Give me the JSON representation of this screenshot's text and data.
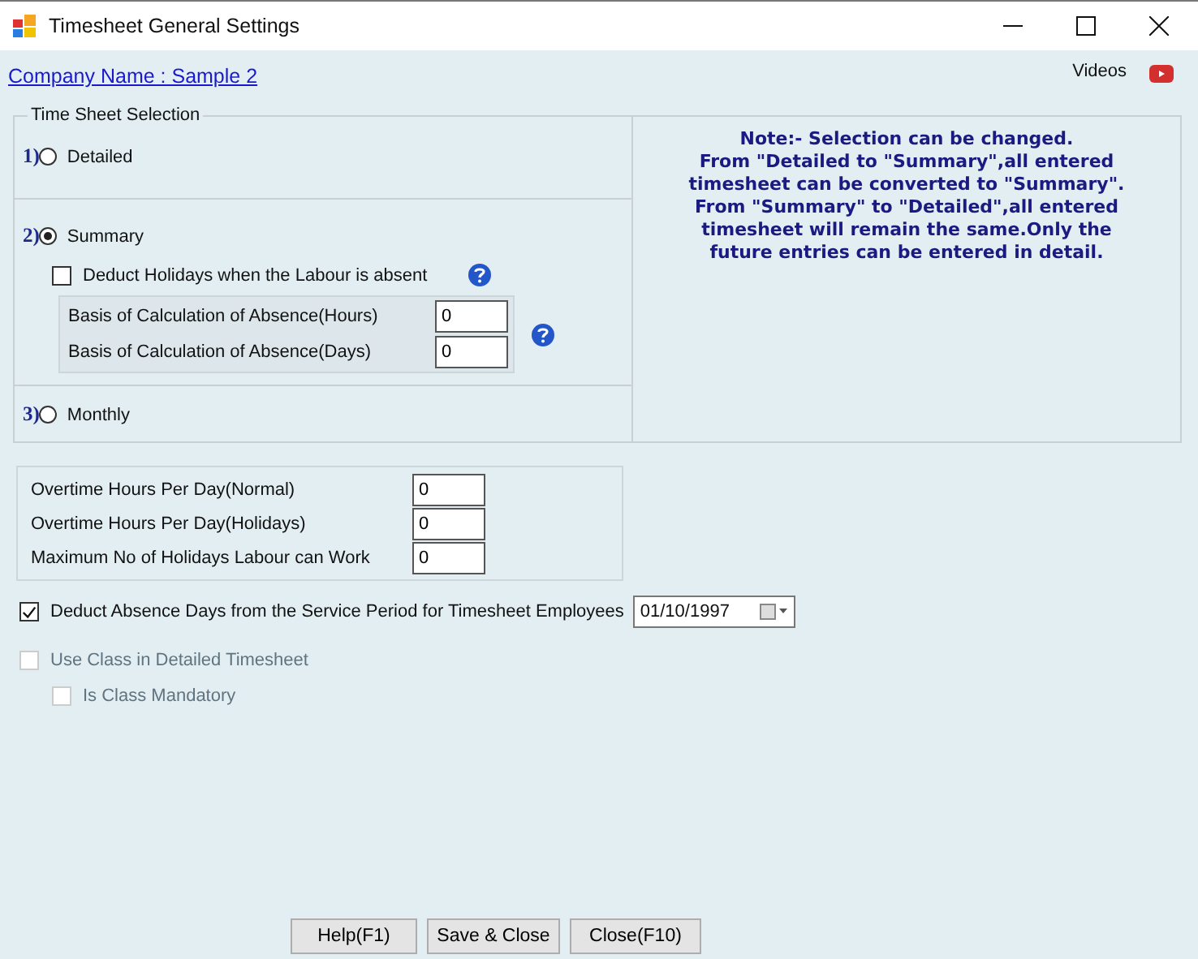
{
  "window": {
    "title": "Timesheet General Settings"
  },
  "company_link": "Company Name : Sample 2",
  "videos_label": "Videos",
  "selection": {
    "title": "Time Sheet Selection",
    "options": [
      {
        "number": "1)",
        "label": "Detailed",
        "selected": false,
        "kind": "plain"
      },
      {
        "number": "2)",
        "label": "Summary",
        "selected": true,
        "kind": "summary",
        "deduct_holidays": {
          "label": "Deduct Holidays when the Labour is absent",
          "checked": false
        },
        "fields": [
          {
            "label": "Basis of Calculation of Absence(Hours)",
            "value": "0"
          },
          {
            "label": "Basis of Calculation of Absence(Days)",
            "value": "0"
          }
        ]
      },
      {
        "number": "3)",
        "label": "Monthly",
        "selected": false,
        "kind": "plain"
      }
    ]
  },
  "note": [
    "Note:- Selection can be changed.",
    "From \"Detailed to \"Summary\",all entered",
    "timesheet can be converted to \"Summary\".",
    "From \"Summary\" to \"Detailed\",all entered",
    "timesheet will remain the same.Only the",
    "future entries can be entered in detail."
  ],
  "overtime_fields": [
    {
      "label": "Overtime Hours Per Day(Normal)",
      "value": "0"
    },
    {
      "label": "Overtime Hours Per Day(Holidays)",
      "value": "0"
    },
    {
      "label": "Maximum No of Holidays Labour can Work",
      "value": "0"
    }
  ],
  "deduct_absence": {
    "label": "Deduct Absence Days from the Service Period for Timesheet Employees",
    "checked": true,
    "date": "01/10/1997"
  },
  "use_class": {
    "label": "Use Class in Detailed Timesheet",
    "checked": false,
    "disabled": true
  },
  "class_mandatory": {
    "label": "Is Class Mandatory",
    "checked": false,
    "disabled": true
  },
  "buttons": [
    "Help(F1)",
    "Save & Close",
    "Close(F10)"
  ]
}
